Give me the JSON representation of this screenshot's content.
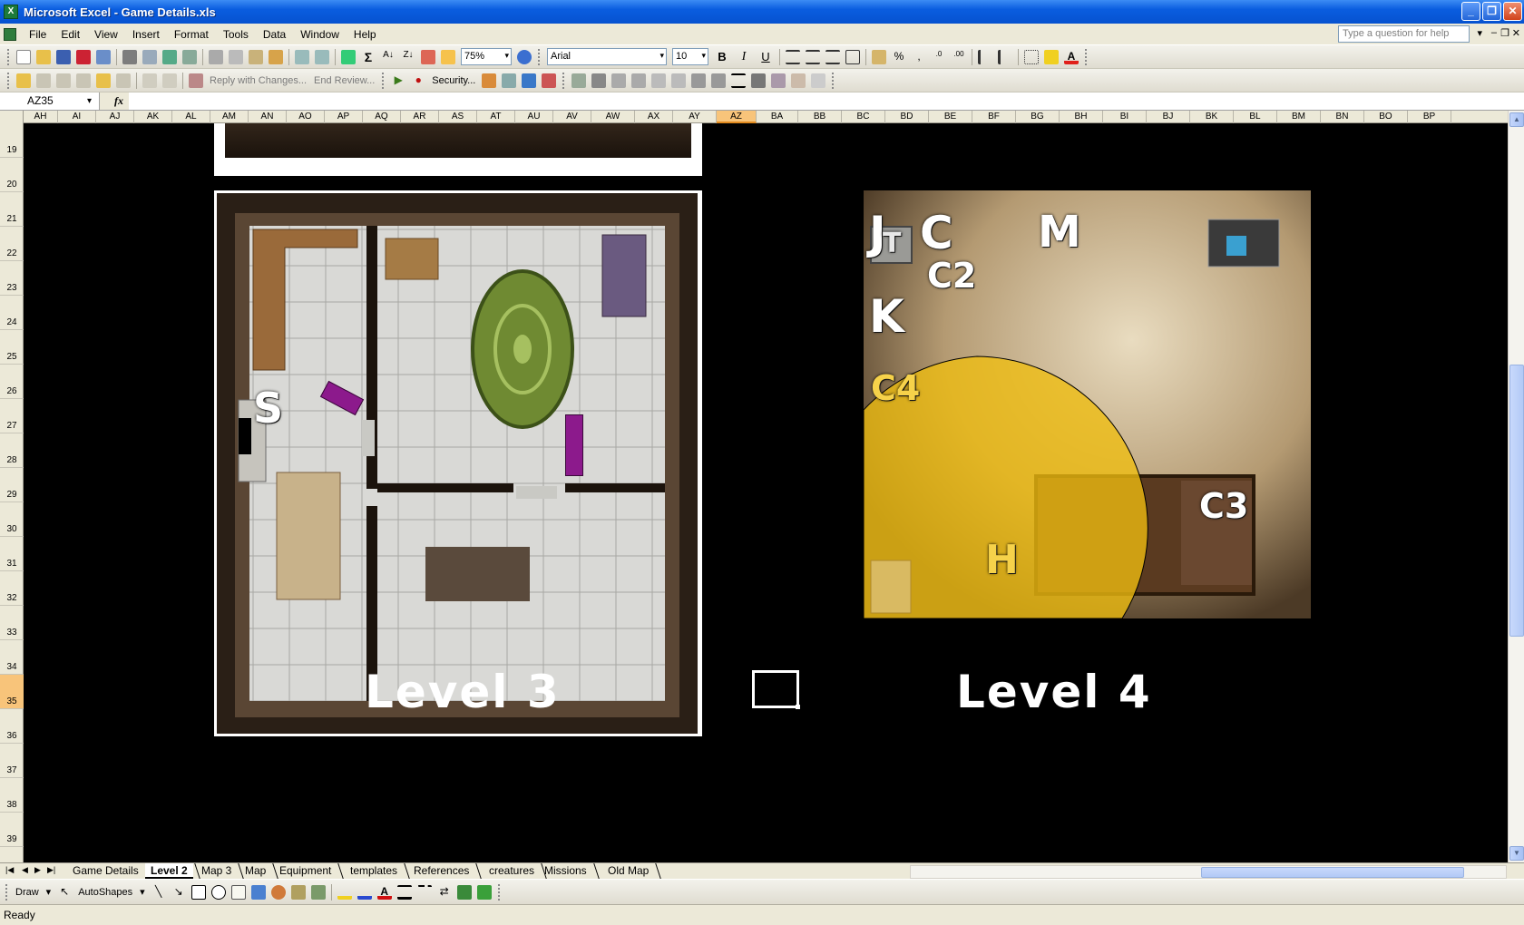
{
  "window": {
    "title": "Microsoft Excel - Game Details.xls"
  },
  "menu": {
    "items": [
      {
        "label": "File",
        "key": "F"
      },
      {
        "label": "Edit",
        "key": "E"
      },
      {
        "label": "View",
        "key": "V"
      },
      {
        "label": "Insert",
        "key": "I"
      },
      {
        "label": "Format",
        "key": "o"
      },
      {
        "label": "Tools",
        "key": "T"
      },
      {
        "label": "Data",
        "key": "D"
      },
      {
        "label": "Window",
        "key": "W"
      },
      {
        "label": "Help",
        "key": "H"
      }
    ],
    "help_placeholder": "Type a question for help"
  },
  "standard_toolbar": {
    "zoom": "75%"
  },
  "formatting_toolbar": {
    "font": "Arial",
    "size": "10",
    "bold": "B",
    "italic": "I",
    "underline": "U",
    "percent": "%"
  },
  "reviewing_toolbar": {
    "reply": "Reply with Changes...",
    "end_review": "End Review...",
    "security": "Security..."
  },
  "formula_bar": {
    "name_box": "AZ35",
    "fx": "fx",
    "formula": ""
  },
  "columns": [
    "AH",
    "AI",
    "AJ",
    "AK",
    "AL",
    "AM",
    "AN",
    "AO",
    "AP",
    "AQ",
    "AR",
    "AS",
    "AT",
    "AU",
    "AV",
    "AW",
    "AX",
    "AY",
    "AZ",
    "BA",
    "BB",
    "BC",
    "BD",
    "BE",
    "BF",
    "BG",
    "BH",
    "BI",
    "BJ",
    "BK",
    "BL",
    "BM",
    "BN",
    "BO",
    "BP"
  ],
  "active_column": "AZ",
  "rows": [
    "19",
    "20",
    "21",
    "22",
    "23",
    "24",
    "25",
    "26",
    "27",
    "28",
    "29",
    "30",
    "31",
    "32",
    "33",
    "34",
    "35",
    "36",
    "37",
    "38",
    "39"
  ],
  "active_row": "35",
  "canvas": {
    "level3_title": "Level 3",
    "level4_title": "Level 4",
    "level3_markers": {
      "s": "S"
    },
    "level4_markers": {
      "j": "J",
      "c": "C",
      "m": "M",
      "t": "T",
      "c2": "C2",
      "k": "K",
      "c4": "C4",
      "h": "H",
      "c3": "C3"
    },
    "colors": {
      "highlight": "#f0be10",
      "marker_purple": "#8c1a8c"
    }
  },
  "sheet_tabs": [
    "Game Details",
    "Level 2",
    "Map 3",
    "Map",
    "Equipment",
    "templates",
    "References",
    "creatures",
    "Missions",
    "Old Map"
  ],
  "active_tab": "Level 2",
  "draw_toolbar": {
    "draw": "Draw",
    "autoshapes": "AutoShapes"
  },
  "status": {
    "text": "Ready"
  }
}
